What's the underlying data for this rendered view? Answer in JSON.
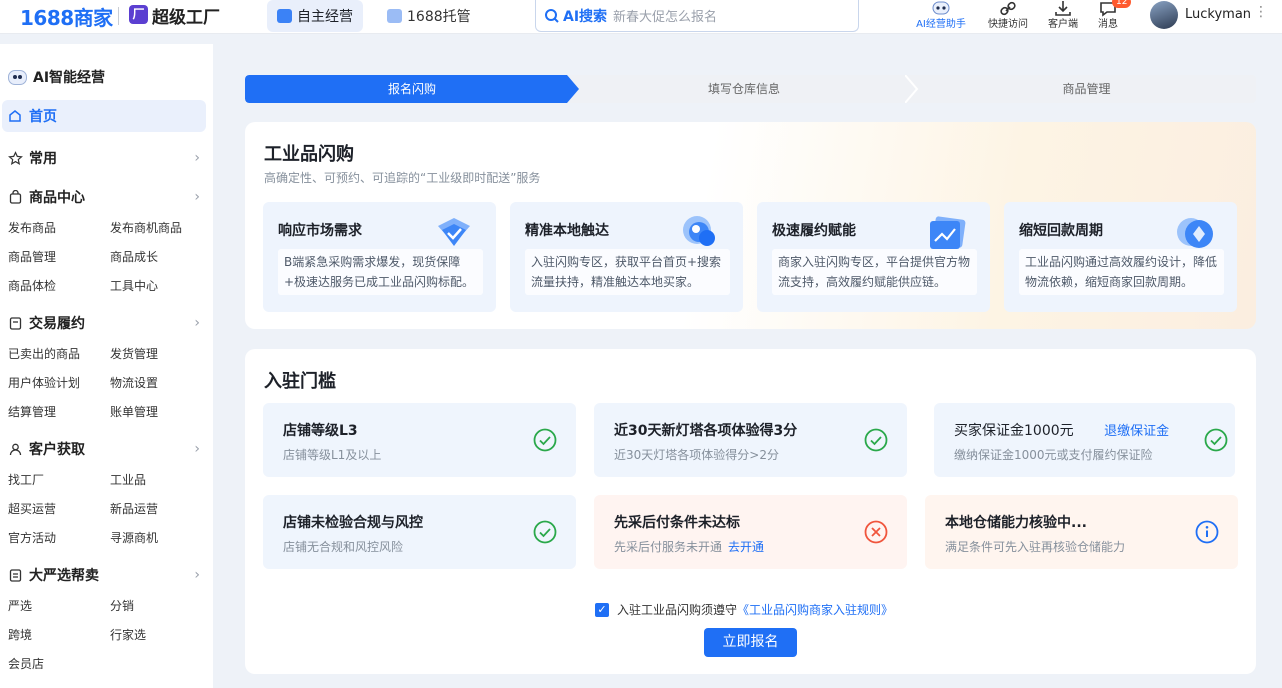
{
  "header": {
    "brand": "1688商家",
    "factory_icon": "factory-logo-icon",
    "factory_name": "超级工厂",
    "tabs": [
      {
        "label": "自主经营",
        "active": true
      },
      {
        "label": "1688托管",
        "active": false
      }
    ],
    "search": {
      "label": "AI搜索",
      "placeholder": "新春大促怎么报名"
    },
    "tools": [
      {
        "label": "AI经营助手",
        "icon": "ai-assistant-icon",
        "accent": true
      },
      {
        "label": "快捷访问",
        "icon": "link-icon"
      },
      {
        "label": "客户端",
        "icon": "download-icon"
      },
      {
        "label": "消息",
        "icon": "message-icon",
        "badge": "12"
      }
    ],
    "username": "Luckyman",
    "more_icon": "⋮"
  },
  "sidebar": {
    "ai_title": "AI智能经营",
    "home": "首页",
    "sections": [
      {
        "label": "常用",
        "icon": "star-icon",
        "items": []
      },
      {
        "label": "商品中心",
        "icon": "bag-icon",
        "items": [
          "发布商品",
          "发布商机商品",
          "商品管理",
          "商品成长",
          "商品体检",
          "工具中心"
        ]
      },
      {
        "label": "交易履约",
        "icon": "receipt-icon",
        "items": [
          "已卖出的商品",
          "发货管理",
          "用户体验计划",
          "物流设置",
          "结算管理",
          "账单管理"
        ]
      },
      {
        "label": "客户获取",
        "icon": "user-icon",
        "items": [
          "找工厂",
          "工业品",
          "超买运营",
          "新品运营",
          "官方活动",
          "寻源商机"
        ]
      },
      {
        "label": "大严选帮卖",
        "icon": "document-icon",
        "items": [
          "严选",
          "分销",
          "跨境",
          "行家选",
          "会员店"
        ]
      }
    ]
  },
  "steps": [
    "报名闪购",
    "填写仓库信息",
    "商品管理"
  ],
  "intro": {
    "title": "工业品闪购",
    "subtitle": "高确定性、可预约、可追踪的“工业级即时配送”服务",
    "features": [
      {
        "title": "响应市场需求",
        "desc": "B端紧急采购需求爆发，现货保障+极速达服务已成工业品闪购标配。",
        "icon": "shield-check-icon"
      },
      {
        "title": "精准本地触达",
        "desc": "入驻闪购专区，获取平台首页+搜索流量扶持，精准触达本地买家。",
        "icon": "location-pin-icon"
      },
      {
        "title": "极速履约赋能",
        "desc": "商家入驻闪购专区，平台提供官方物流支持，高效履约赋能供应链。",
        "icon": "trend-chart-icon"
      },
      {
        "title": "缩短回款周期",
        "desc": "工业品闪购通过高效履约设计，降低物流依赖，缩短商家回款周期。",
        "icon": "coin-icon"
      }
    ]
  },
  "threshold": {
    "title": "入驻门槛",
    "items": [
      {
        "title": "店铺等级L3",
        "desc": "店铺等级L1及以上",
        "status": "pass"
      },
      {
        "title": "近30天新灯塔各项体验得3分",
        "desc": "近30天灯塔各项体验得分>2分",
        "status": "pass"
      },
      {
        "title": "买家保证金1000元",
        "title_link": "退缴保证金",
        "desc": "缴纳保证金1000元或支付履约保证险",
        "status": "pass"
      },
      {
        "title": "店铺未检验合规与风控",
        "desc": "店铺无合规和风控风险",
        "status": "pass"
      },
      {
        "title": "先采后付条件未达标",
        "desc": "先采后付服务未开通",
        "desc_link": "去开通",
        "status": "fail"
      },
      {
        "title": "本地仓储能力核验中...",
        "desc": "满足条件可先入驻再核验仓储能力",
        "status": "pending"
      }
    ],
    "agree_text": "入驻工业品闪购须遵守",
    "agree_link": "《工业品闪购商家入驻规则》",
    "agree_checked": true,
    "submit": "立即报名"
  },
  "colors": {
    "primary": "#1f6ff5",
    "success": "#2aa84a",
    "danger": "#f0553d",
    "info": "#1f6ff5"
  }
}
